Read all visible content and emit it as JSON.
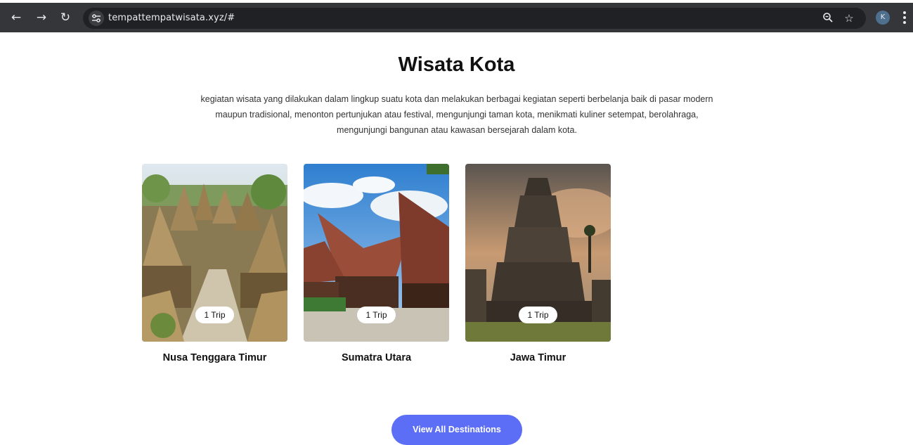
{
  "browser": {
    "url": "tempattempatwisata.xyz/#",
    "profile_initial": "K",
    "icons": [
      "back-arrow-icon",
      "forward-arrow-icon",
      "reload-icon",
      "site-settings-icon",
      "zoom-icon",
      "bookmark-star-icon",
      "more-menu-icon"
    ]
  },
  "section": {
    "title": "Wisata Kota",
    "description": "kegiatan wisata yang dilakukan dalam lingkup suatu kota dan melakukan berbagai kegiatan seperti berbelanja baik di pasar modern maupun tradisional, menonton pertunjukan atau festival, mengunjungi taman kota, menikmati kuliner setempat, berolahraga, mengunjungi bangunan atau kawasan bersejarah dalam kota."
  },
  "destinations": [
    {
      "name": "Nusa Tenggara Timur",
      "badge": "1 Trip"
    },
    {
      "name": "Sumatra Utara",
      "badge": "1 Trip"
    },
    {
      "name": "Jawa Timur",
      "badge": "1 Trip"
    }
  ],
  "cta": {
    "label": "View All Destinations"
  },
  "colors": {
    "accent": "#5b6ef5",
    "chrome": "#35363a",
    "omnibox": "#202124"
  }
}
